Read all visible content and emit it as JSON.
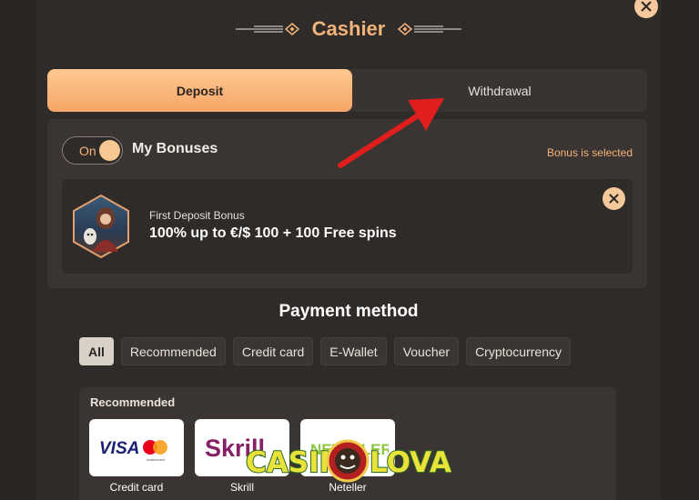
{
  "header": {
    "title": "Cashier",
    "close_icon": "close-icon"
  },
  "tabs": {
    "deposit": "Deposit",
    "withdrawal": "Withdrawal",
    "active": "Deposit"
  },
  "bonuses": {
    "toggle_label": "On",
    "toggle_state": true,
    "title": "My Bonuses",
    "status": "Bonus is selected",
    "card": {
      "subtitle": "First Deposit Bonus",
      "title": "100% up to €/$ 100 + 100 Free spins"
    }
  },
  "payment": {
    "title": "Payment method",
    "filters": [
      "All",
      "Recommended",
      "Credit card",
      "E-Wallet",
      "Voucher",
      "Cryptocurrency"
    ],
    "active_filter": "All",
    "recommended_title": "Recommended",
    "methods": [
      {
        "label": "Credit card",
        "logo": "VISA"
      },
      {
        "label": "Skrill",
        "logo": "Skrill"
      },
      {
        "label": "Neteller",
        "logo": "NETELLER"
      }
    ]
  },
  "watermark": {
    "left": "CASIN",
    "right": "LOVAC"
  },
  "colors": {
    "accent": "#f3b37a",
    "tab_active": "#f6a567",
    "background": "#2f2b29",
    "panel": "#3a3532",
    "arrow": "#e01e1e"
  }
}
